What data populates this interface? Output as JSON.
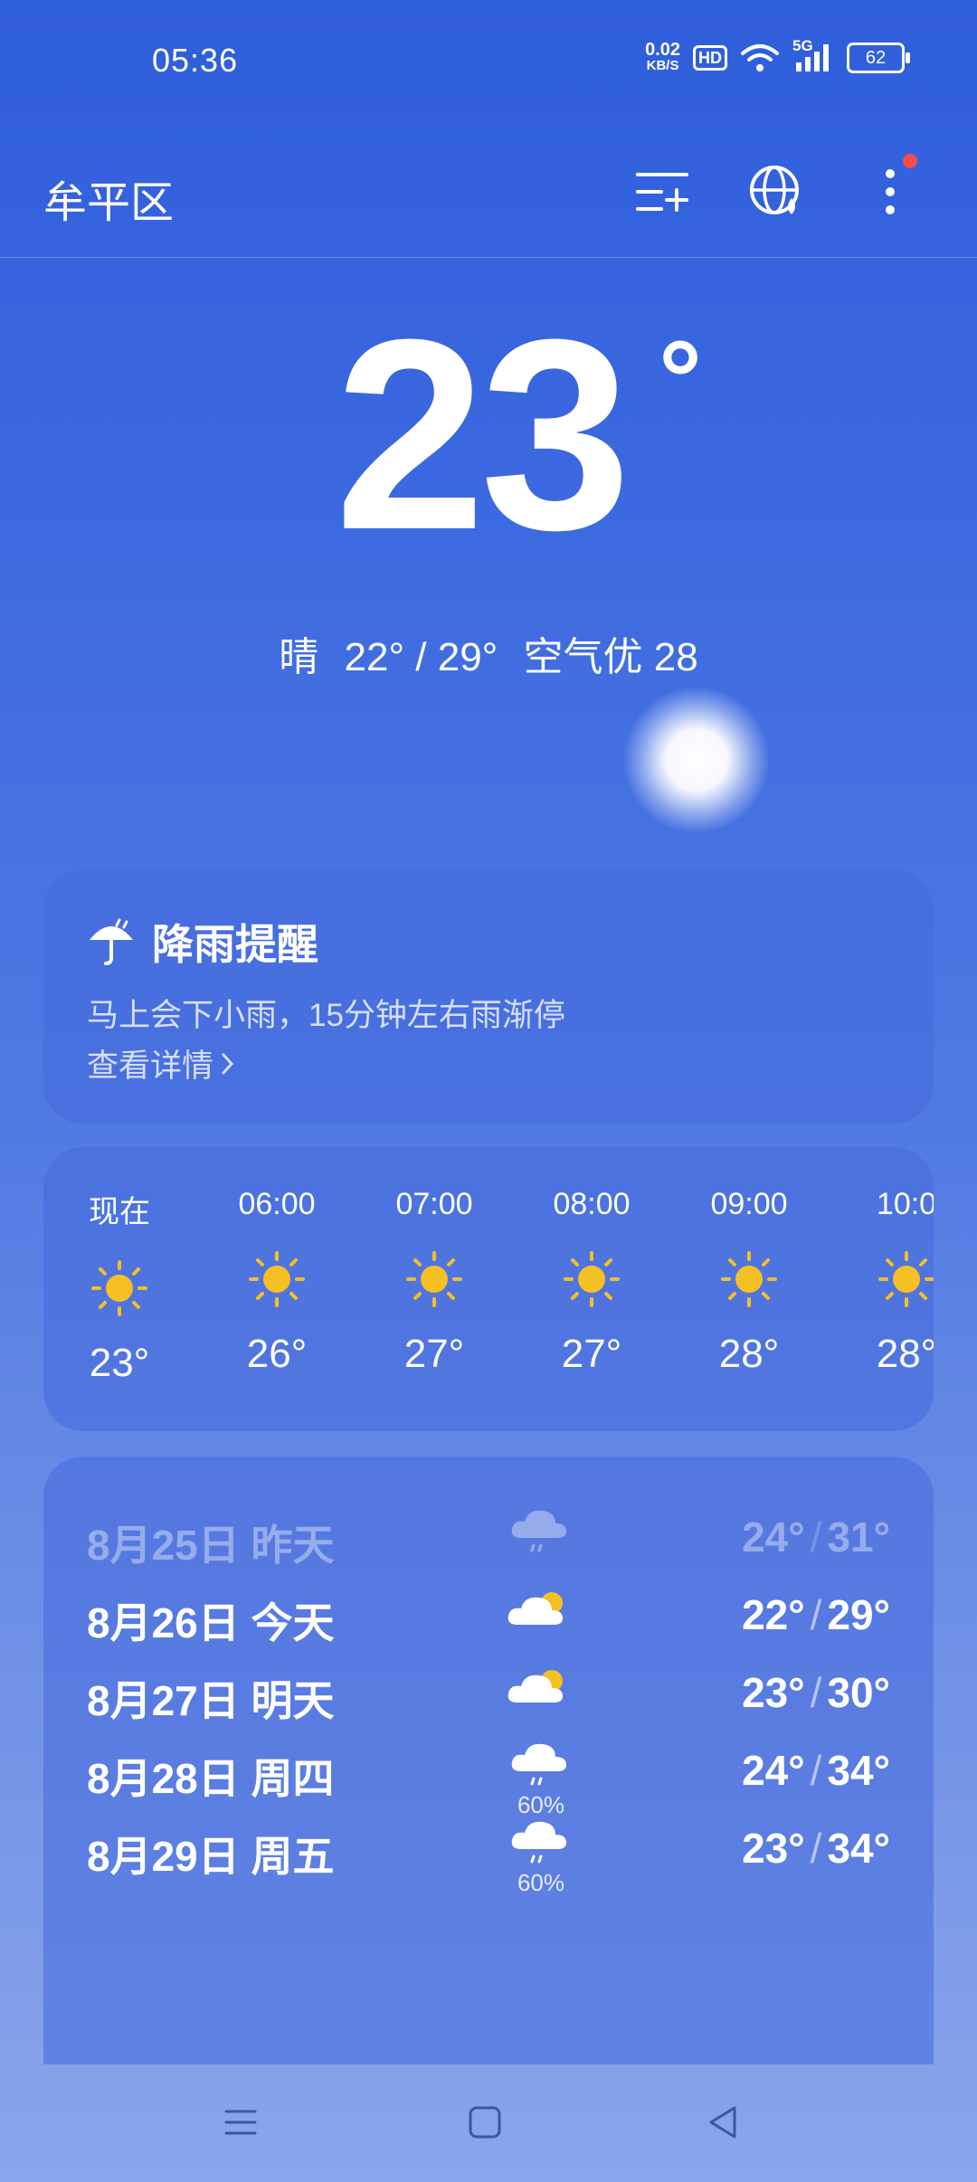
{
  "status_bar": {
    "time": "05:36",
    "net_speed_value": "0.02",
    "net_speed_unit": "KB/S",
    "hd_label": "HD",
    "signal_label": "5G",
    "battery": "62"
  },
  "header": {
    "city": "牟平区",
    "icons": [
      "city-list-add-icon",
      "globe-icon",
      "more-icon"
    ]
  },
  "current": {
    "temperature": "23",
    "degree": "°",
    "condition": "晴",
    "range": "22° / 29°",
    "air_quality": "空气优 28"
  },
  "rain_alert": {
    "title": "降雨提醒",
    "description": "马上会下小雨，15分钟左右雨渐停",
    "link": "查看详情"
  },
  "hourly": [
    {
      "time": "现在",
      "icon": "sun-icon",
      "temp": "23°"
    },
    {
      "time": "06:00",
      "icon": "sun-icon",
      "temp": "26°"
    },
    {
      "time": "07:00",
      "icon": "sun-icon",
      "temp": "27°"
    },
    {
      "time": "08:00",
      "icon": "sun-icon",
      "temp": "27°"
    },
    {
      "time": "09:00",
      "icon": "sun-icon",
      "temp": "28°"
    },
    {
      "time": "10:0",
      "icon": "sun-icon",
      "temp": "28°"
    }
  ],
  "daily": [
    {
      "date": "8月25日",
      "day": "昨天",
      "icon": "rain-cloud-icon",
      "precip": "",
      "low": "24°",
      "high": "31°",
      "past": true
    },
    {
      "date": "8月26日",
      "day": "今天",
      "icon": "partly-cloudy-icon",
      "precip": "",
      "low": "22°",
      "high": "29°"
    },
    {
      "date": "8月27日",
      "day": "明天",
      "icon": "partly-cloudy-icon",
      "precip": "",
      "low": "23°",
      "high": "30°"
    },
    {
      "date": "8月28日",
      "day": "周四",
      "icon": "rain-cloud-icon",
      "precip": "60%",
      "low": "24°",
      "high": "34°"
    },
    {
      "date": "8月29日",
      "day": "周五",
      "icon": "rain-cloud-icon",
      "precip": "60%",
      "low": "23°",
      "high": "34°"
    }
  ],
  "colors": {
    "sun": "#f5c024",
    "alert_dot": "#ff4b4b",
    "background_top": "#2f5edc",
    "background_bottom": "#8aa6ea"
  }
}
